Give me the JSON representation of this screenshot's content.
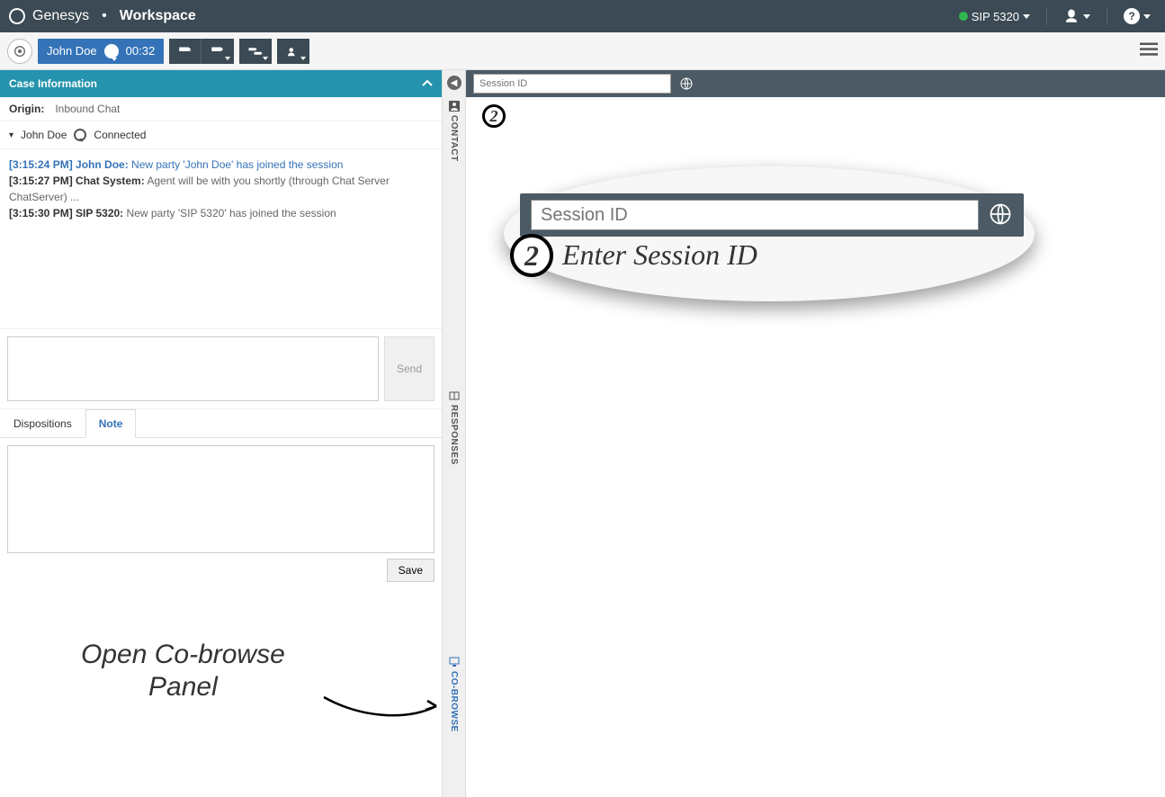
{
  "header": {
    "brand": "Genesys",
    "product": "Workspace",
    "agent_sip": "SIP 5320"
  },
  "toolbar": {
    "contact_name": "John Doe",
    "timer": "00:32"
  },
  "case": {
    "title": "Case Information",
    "origin_label": "Origin:",
    "origin_value": "Inbound Chat"
  },
  "party": {
    "name": "John Doe",
    "status": "Connected"
  },
  "transcript": [
    {
      "ts": "[3:15:24 PM]",
      "sender": "John Doe:",
      "body": "New party 'John Doe' has joined the session",
      "style": "blue"
    },
    {
      "ts": "[3:15:27 PM]",
      "sender": "Chat System:",
      "body": "Agent will be with you shortly (through Chat Server ChatServer) ...",
      "style": "gray"
    },
    {
      "ts": "[3:15:30 PM]",
      "sender": "SIP 5320:",
      "body": "New party 'SIP 5320' has joined the session",
      "style": "gray"
    }
  ],
  "compose": {
    "send_label": "Send"
  },
  "tabs": {
    "dispositions": "Dispositions",
    "note": "Note",
    "save": "Save"
  },
  "rail": {
    "contact": "CONTACT",
    "responses": "RESPONSES",
    "cobrowse": "CO-BROWSE"
  },
  "session": {
    "placeholder": "Session ID"
  },
  "annotations": {
    "step2_number": "2",
    "enter_session": "Enter Session ID",
    "open_cobrowse_1": "Open Co-browse",
    "open_cobrowse_2": "Panel"
  }
}
